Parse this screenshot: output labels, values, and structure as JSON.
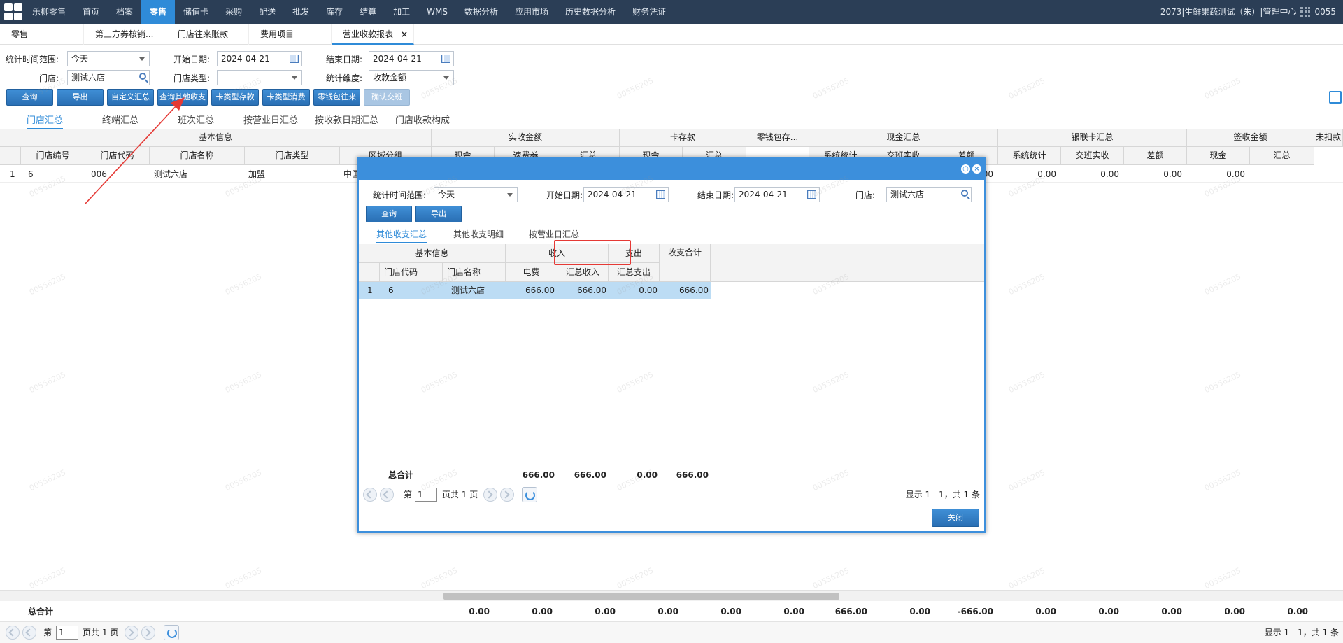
{
  "topnav": {
    "items": [
      "乐柳零售",
      "首页",
      "档案",
      "零售",
      "储值卡",
      "采购",
      "配送",
      "批发",
      "库存",
      "结算",
      "加工",
      "WMS",
      "数据分析",
      "应用市场",
      "历史数据分析",
      "财务凭证"
    ],
    "active_index": 3,
    "store_info": "2073|生鲜果蔬测试（朱）|管理中心",
    "user_code": "0055"
  },
  "tabs": [
    "零售",
    "第三方券核销...",
    "门店往来账款",
    "费用项目",
    "营业收款报表"
  ],
  "filters": {
    "range_label": "统计时间范围:",
    "range_value": "今天",
    "start_label": "开始日期:",
    "start_value": "2024-04-21",
    "end_label": "结束日期:",
    "end_value": "2024-04-21",
    "store_label": "门店:",
    "store_value": "测试六店",
    "store_type_label": "门店类型:",
    "store_type_value": "",
    "dimension_label": "统计维度:",
    "dimension_value": "收款金额"
  },
  "buttons": [
    "查询",
    "导出",
    "自定义汇总",
    "查询其他收支",
    "卡类型存款",
    "卡类型消费",
    "零钱包往来",
    "确认交班"
  ],
  "subtabs": [
    "门店汇总",
    "终端汇总",
    "班次汇总",
    "按营业日汇总",
    "按收款日期汇总",
    "门店收款构成"
  ],
  "grid": {
    "group_headers": [
      "基本信息",
      "实收金额",
      "卡存款",
      "零钱包存...",
      "现金汇总",
      "银联卡汇总",
      "签收金额",
      "未扣款"
    ],
    "col_headers": [
      "门店编号",
      "门店代码",
      "门店名称",
      "门店类型",
      "区域分组",
      "现金",
      "速费券",
      "汇总",
      "现金",
      "汇总",
      "系统统计",
      "交班实收",
      "差额",
      "系统统计",
      "交班实收",
      "差额",
      "现金",
      "汇总"
    ],
    "row": {
      "index": "1",
      "store_no": "6",
      "store_code": "006",
      "store_name": "测试六店",
      "store_type": "加盟",
      "region": "中国"
    },
    "right_values": [
      "0",
      "0.00",
      "0.00",
      "0.00",
      "0.00",
      "0.00"
    ],
    "totals_label": "总合计",
    "totals": [
      "0.00",
      "0.00",
      "0.00",
      "0.00",
      "0.00",
      "0.00",
      "666.00",
      "0.00",
      "-666.00",
      "0.00",
      "0.00",
      "0.00",
      "0.00",
      "0.00"
    ],
    "pager": {
      "prefix": "第",
      "page": "1",
      "suffix": "页共 1 页",
      "summary": "显示 1 - 1，共 1 条"
    }
  },
  "dialog": {
    "range_label": "统计时间范围:",
    "range_value": "今天",
    "start_label": "开始日期:",
    "start_value": "2024-04-21",
    "end_label": "结束日期:",
    "end_value": "2024-04-21",
    "store_label": "门店:",
    "store_value": "测试六店",
    "query_label": "查询",
    "export_label": "导出",
    "subtabs": [
      "其他收支汇总",
      "其他收支明细",
      "按营业日汇总"
    ],
    "group_headers": [
      "基本信息",
      "收入",
      "支出",
      "收支合计"
    ],
    "col_headers": [
      "门店代码",
      "门店名称",
      "电费",
      "汇总收入",
      "汇总支出"
    ],
    "row": {
      "index": "1",
      "store_code": "6",
      "store_name": "测试六店",
      "electric": "666.00",
      "income_total": "666.00",
      "expense_total": "0.00",
      "net": "666.00"
    },
    "totals_label": "总合计",
    "totals": [
      "666.00",
      "666.00",
      "0.00",
      "666.00"
    ],
    "pager": {
      "prefix": "第",
      "page": "1",
      "suffix": "页共 1 页",
      "summary": "显示 1 - 1，共 1 条"
    },
    "close_label": "关闭"
  },
  "annotation": {
    "highlight_color": "#e53935"
  },
  "watermark": "00556205"
}
